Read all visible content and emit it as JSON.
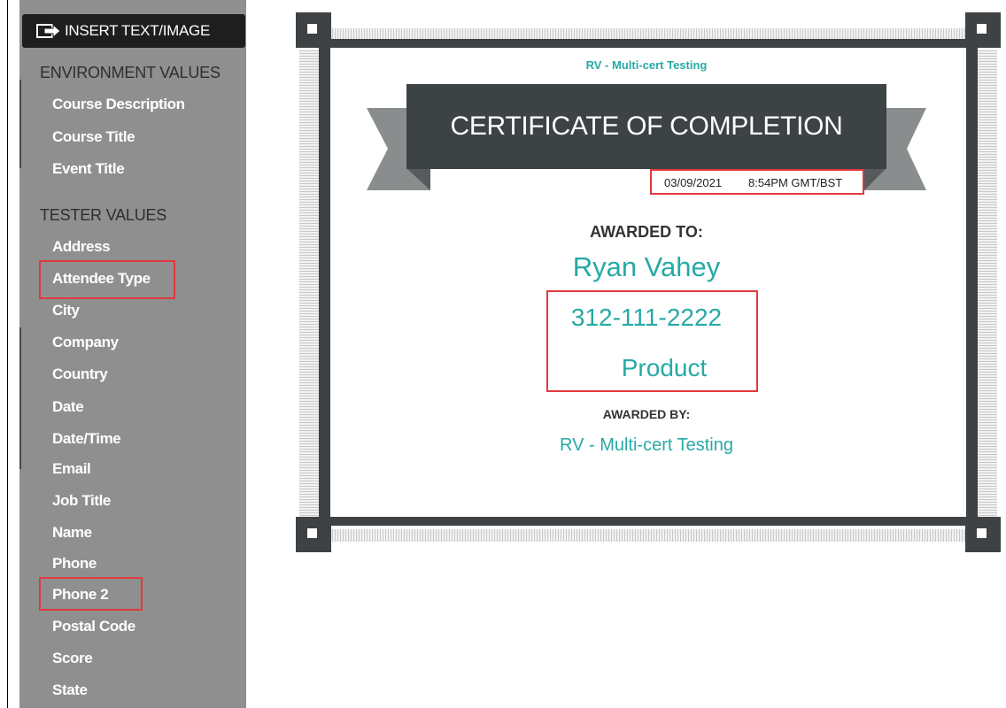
{
  "sidebar": {
    "insert_label": "INSERT TEXT/IMAGE",
    "environment_heading": "ENVIRONMENT VALUES",
    "environment_items": [
      "Course Description",
      "Course Title",
      "Event Title"
    ],
    "tester_heading": "TESTER VALUES",
    "tester_items": [
      "Address",
      "Attendee Type",
      "City",
      "Company",
      "Country",
      "Date",
      "Date/Time",
      "Email",
      "Job Title",
      "Name",
      "Phone",
      "Phone 2",
      "Postal Code",
      "Score",
      "State"
    ],
    "highlighted_items": [
      "Attendee Type",
      "Phone 2"
    ]
  },
  "certificate": {
    "org_name": "RV - Multi-cert Testing",
    "banner_title": "CERTIFICATE OF COMPLETION",
    "date": "03/09/2021",
    "time": "8:54PM GMT/BST",
    "awarded_to_label": "AWARDED TO:",
    "recipient": "Ryan Vahey",
    "phone": "312-111-2222",
    "attendee_type": "Product",
    "awarded_by_label": "AWARDED BY:",
    "awarded_by": "RV - Multi-cert Testing"
  },
  "colors": {
    "accent": "#26aaa5",
    "banner": "#3d4245",
    "ribbon": "#8a8d8d",
    "frame": "#3f4244",
    "highlight": "#e0393e",
    "sidebar_bg": "#8f8f8f"
  },
  "icons": {
    "insert": "arrow-right-box-icon"
  }
}
